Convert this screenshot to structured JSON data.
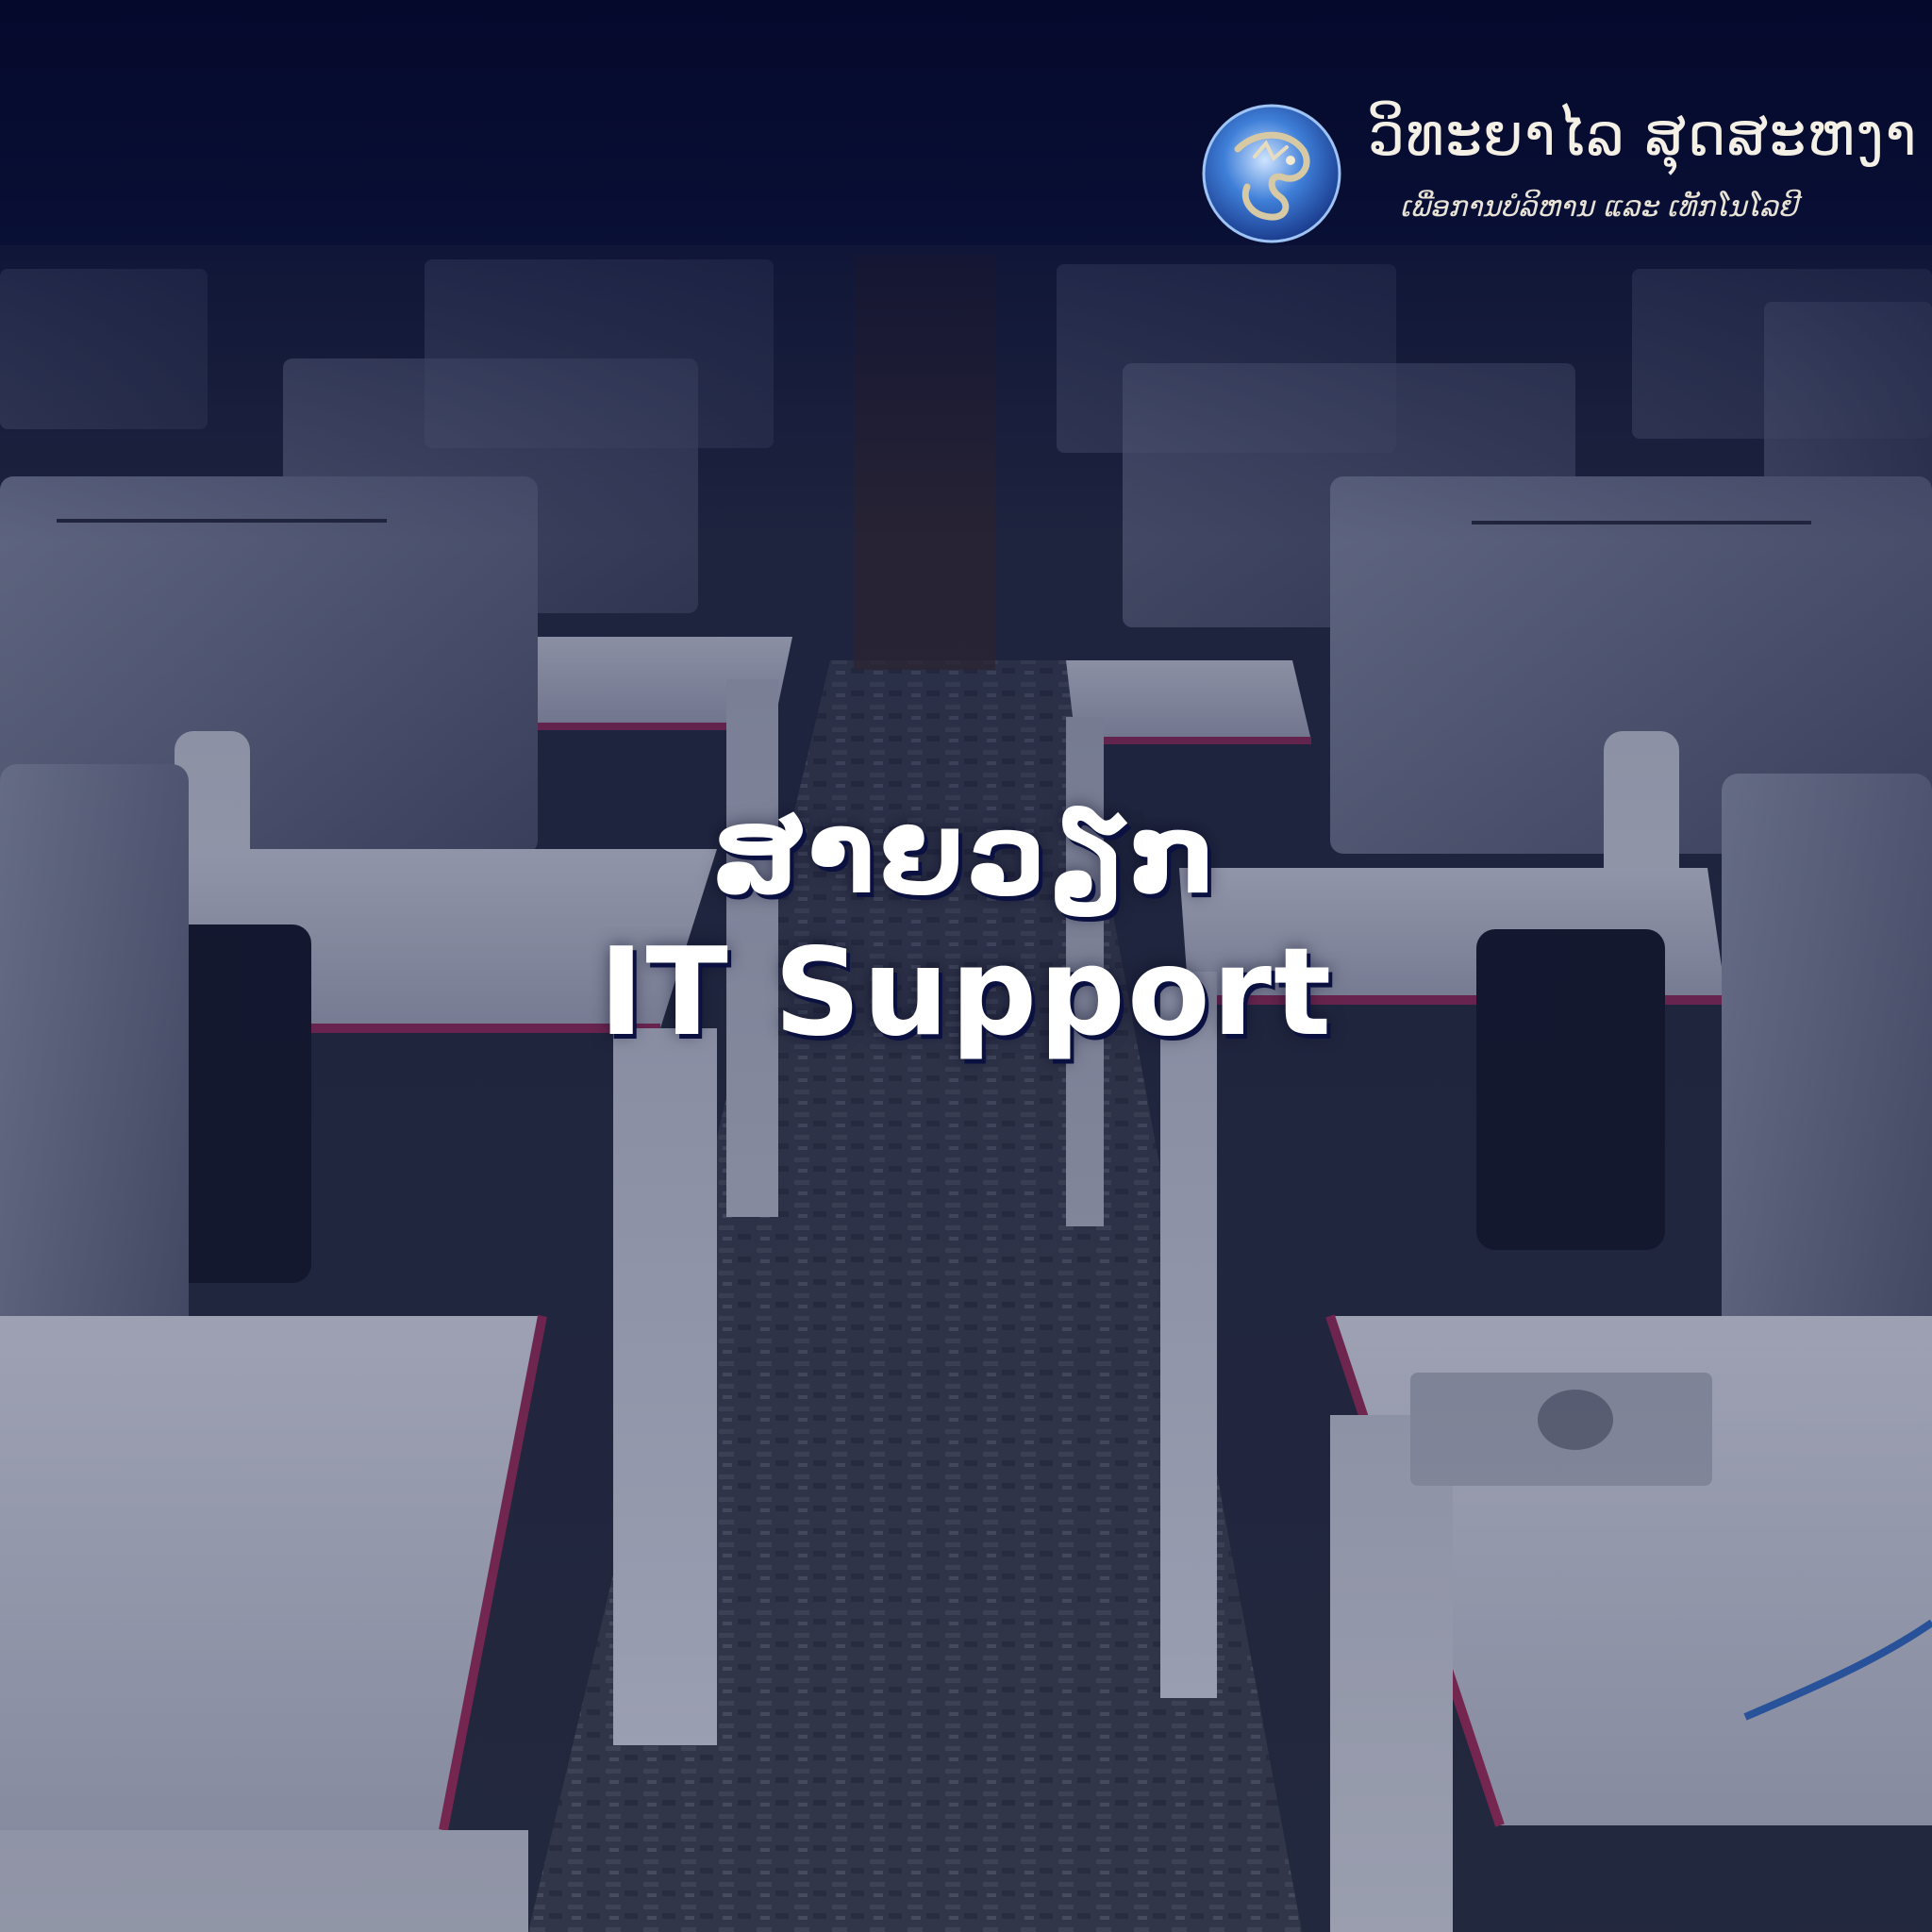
{
  "brand": {
    "name": "ວິທະຍາໄລ ສຸດສະຫງາ",
    "tagline": "ເພື່ອການບໍລິຫານ ແລະ ເທັກໂນໂລຢີ",
    "emblem_icon": "dragon-emblem-icon"
  },
  "headline": {
    "lao": "ສາຍວຽກ",
    "english": "IT Support"
  },
  "colors": {
    "background_top": "#060b2b",
    "overlay": "#0c1440",
    "text": "#ffffff",
    "desk_accent": "#8a2a55"
  }
}
